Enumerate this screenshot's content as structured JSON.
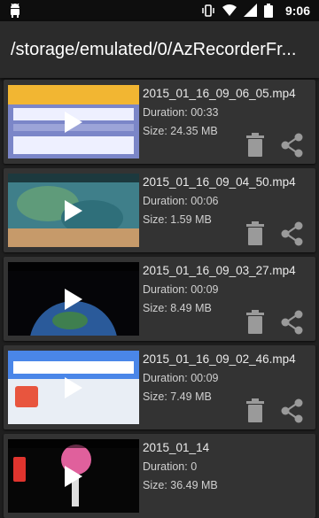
{
  "status_bar": {
    "time": "9:06"
  },
  "toolbar": {
    "path": "/storage/emulated/0/AzRecorderFr..."
  },
  "videos": [
    {
      "file_name": "2015_01_16_09_06_05.mp4",
      "duration": "Duration: 00:33",
      "size": "Size: 24.35 MB"
    },
    {
      "file_name": "2015_01_16_09_04_50.mp4",
      "duration": "Duration: 00:06",
      "size": "Size: 1.59 MB"
    },
    {
      "file_name": "2015_01_16_09_03_27.mp4",
      "duration": "Duration: 00:09",
      "size": "Size: 8.49 MB"
    },
    {
      "file_name": "2015_01_16_09_02_46.mp4",
      "duration": "Duration: 00:09",
      "size": "Size: 7.49 MB"
    },
    {
      "file_name": "2015_01_14",
      "duration": "Duration: 0",
      "size": "Size: 36.49 MB"
    }
  ],
  "icons": {
    "delete": "trash-icon",
    "share": "share-icon",
    "play": "play-icon"
  },
  "colors": {
    "background": "#1f1f1f",
    "card": "#333333",
    "toolbar": "#2b2b2b",
    "icon": "#9a9a9a"
  }
}
